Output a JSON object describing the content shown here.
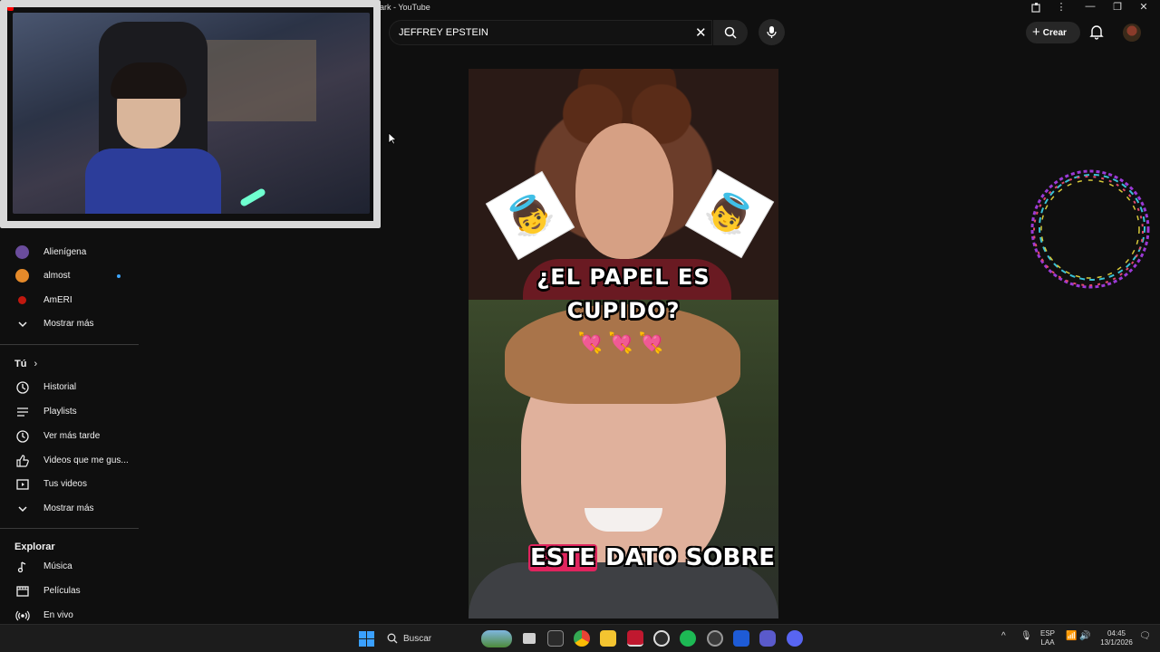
{
  "window": {
    "title": "ark - YouTube",
    "controls": [
      "—",
      "❐",
      "✕"
    ]
  },
  "header": {
    "search_value": "JEFFREY EPSTEIN",
    "create_label": "Crear"
  },
  "sidebar": {
    "subscriptions": [
      {
        "label": "Alienígena",
        "color": "#6a4c9c"
      },
      {
        "label": "almost",
        "color": "#e58a2a",
        "new": true
      },
      {
        "label": "AmERI",
        "color": "#c0180f"
      }
    ],
    "show_more_1": "Mostrar más",
    "you_heading": "Tú",
    "you_items": [
      {
        "label": "Historial",
        "icon": "history-icon"
      },
      {
        "label": "Playlists",
        "icon": "playlist-icon"
      },
      {
        "label": "Ver más tarde",
        "icon": "watch-later-icon"
      },
      {
        "label": "Videos que me gus...",
        "icon": "like-icon"
      },
      {
        "label": "Tus videos",
        "icon": "your-videos-icon"
      }
    ],
    "show_more_2": "Mostrar más",
    "explore_heading": "Explorar",
    "explore_items": [
      {
        "label": "Música",
        "icon": "music-icon"
      },
      {
        "label": "Películas",
        "icon": "movies-icon"
      },
      {
        "label": "En vivo",
        "icon": "live-icon"
      }
    ]
  },
  "short": {
    "caption_top_line1": "¿EL PAPEL ES",
    "caption_top_line2": "CUPIDO?",
    "hearts": "💘💘💘",
    "caption_bottom_highlight": "ESTE",
    "caption_bottom_rest": "DATO SOBRE"
  },
  "taskbar": {
    "search_label": "Buscar",
    "lang_line1": "ESP",
    "lang_line2": "LAA",
    "time": "04:45",
    "date": "13/1/2026"
  }
}
